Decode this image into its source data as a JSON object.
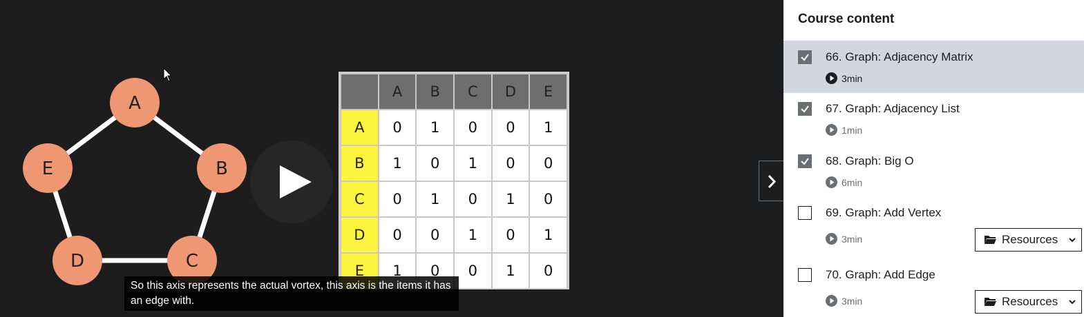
{
  "video": {
    "graph": {
      "nodes": [
        {
          "label": "A"
        },
        {
          "label": "B"
        },
        {
          "label": "C"
        },
        {
          "label": "D"
        },
        {
          "label": "E"
        }
      ]
    },
    "matrix": {
      "columns": [
        "A",
        "B",
        "C",
        "D",
        "E"
      ],
      "rows": [
        {
          "label": "A",
          "values": [
            "0",
            "1",
            "0",
            "0",
            "1"
          ]
        },
        {
          "label": "B",
          "values": [
            "1",
            "0",
            "1",
            "0",
            "0"
          ]
        },
        {
          "label": "C",
          "values": [
            "0",
            "1",
            "0",
            "1",
            "0"
          ]
        },
        {
          "label": "D",
          "values": [
            "0",
            "0",
            "1",
            "0",
            "1"
          ]
        },
        {
          "label": "E",
          "values": [
            "1",
            "0",
            "0",
            "1",
            "0"
          ]
        }
      ]
    },
    "caption": "So this axis represents the actual vortex, this axis is the items it has an edge with.",
    "colors": {
      "node": "#ef9672",
      "row_header": "#fff43d",
      "column_header": "#6e6e6e"
    }
  },
  "sidebar": {
    "title": "Course content",
    "lectures": [
      {
        "title": "66. Graph: Adjacency Matrix",
        "duration": "3min",
        "completed": true,
        "active": true
      },
      {
        "title": "67. Graph: Adjacency List",
        "duration": "1min",
        "completed": true,
        "active": false
      },
      {
        "title": "68. Graph: Big O",
        "duration": "6min",
        "completed": true,
        "active": false
      },
      {
        "title": "69. Graph: Add Vertex",
        "duration": "3min",
        "completed": false,
        "active": false,
        "resources": "Resources"
      },
      {
        "title": "70. Graph: Add Edge",
        "duration": "3min",
        "completed": false,
        "active": false,
        "resources": "Resources"
      }
    ]
  }
}
